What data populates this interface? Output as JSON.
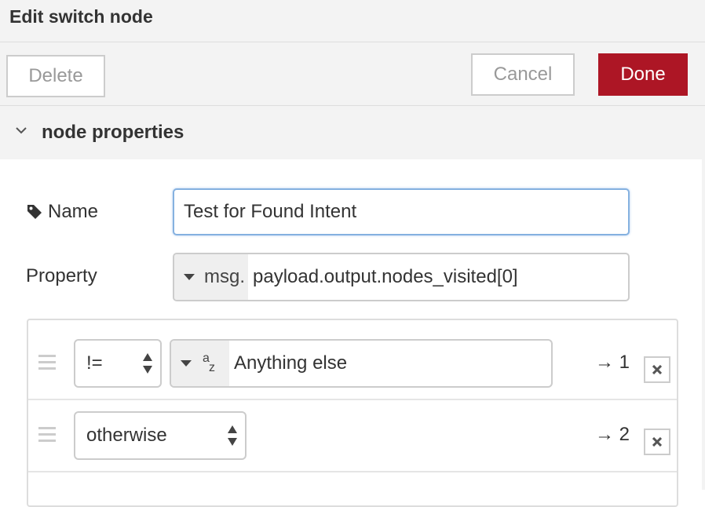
{
  "header": {
    "title": "Edit switch node"
  },
  "toolbar": {
    "delete_label": "Delete",
    "cancel_label": "Cancel",
    "done_label": "Done"
  },
  "section": {
    "label": "node properties",
    "icon": "chevron-down-icon"
  },
  "form": {
    "name_label": "Name",
    "name_icon": "tag-icon",
    "name_value": "Test for Found Intent",
    "property_label": "Property",
    "property_type": "msg.",
    "property_value": "payload.output.nodes_visited[0]"
  },
  "rules": [
    {
      "operator": "!=",
      "value_type_icon": "string-az-icon",
      "value": "Anything else",
      "output": "→ 1"
    },
    {
      "operator": "otherwise",
      "output": "→ 2"
    }
  ],
  "colors": {
    "accent": "#ad1625",
    "focus_border": "#85b1e0",
    "panel_bg": "#f3f3f3"
  }
}
